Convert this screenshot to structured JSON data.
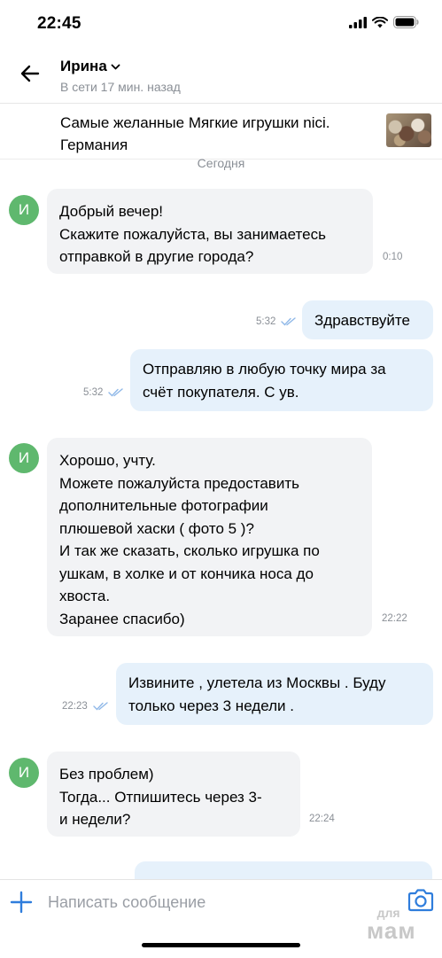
{
  "status_bar": {
    "time": "22:45"
  },
  "header": {
    "name": "Ирина",
    "status": "В сети 17 мин. назад"
  },
  "product": {
    "title_line1": "Самые желанные Мягкие игрушки nici.",
    "title_line2": "Германия"
  },
  "date_separator": "Сегодня",
  "avatar_letter": "И",
  "messages": [
    {
      "dir": "in",
      "lines": [
        "Добрый вечер!",
        "Скажите пожалуйста, вы занимаетесь",
        "отправкой в другие города?"
      ],
      "time": "0:10"
    },
    {
      "dir": "out",
      "lines": [
        "Здравствуйте"
      ],
      "time": "5:32"
    },
    {
      "dir": "out",
      "lines": [
        "Отправляю в любую точку мира за",
        "счёт покупателя. С ув."
      ],
      "time": "5:32"
    },
    {
      "dir": "in",
      "lines": [
        "Хорошо, учту.",
        "Можете пожалуйста предоставить",
        "дополнительные фотографии",
        "плюшевой хаски ( фото 5 )?",
        "И так же сказать, сколько игрушка по",
        "ушкам, в холке и от кончика носа до",
        "хвоста.",
        "Заранее спасибо)"
      ],
      "time": "22:22"
    },
    {
      "dir": "out",
      "lines": [
        "Извините , улетела из Москвы . Буду",
        "только через 3 недели ."
      ],
      "time": "22:23"
    },
    {
      "dir": "in",
      "lines": [
        "Без проблем)",
        "Тогда... Отпишитесь через 3-",
        "и недели?"
      ],
      "time": "22:24"
    }
  ],
  "input": {
    "placeholder": "Написать сообщение"
  },
  "watermark": {
    "line1": "для",
    "line2": "мам"
  },
  "colors": {
    "accent": "#2f7ddc",
    "avatar": "#5fb86e",
    "in_bubble": "#f2f3f5",
    "out_bubble": "#e6f1fb",
    "read_check": "#8fb8e8"
  }
}
